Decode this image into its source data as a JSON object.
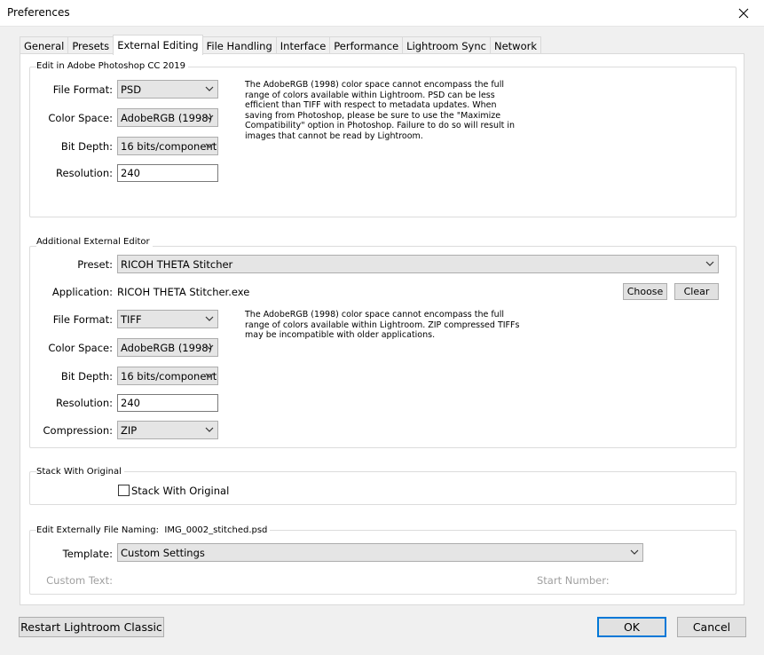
{
  "window": {
    "title": "Preferences"
  },
  "tabs": [
    {
      "label": "General"
    },
    {
      "label": "Presets"
    },
    {
      "label": "External Editing"
    },
    {
      "label": "File Handling"
    },
    {
      "label": "Interface"
    },
    {
      "label": "Performance"
    },
    {
      "label": "Lightroom Sync"
    },
    {
      "label": "Network"
    }
  ],
  "edit_in_photoshop": {
    "title": "Edit in Adobe Photoshop CC 2019",
    "file_format_label": "File Format:",
    "file_format": "PSD",
    "color_space_label": "Color Space:",
    "color_space": "AdobeRGB (1998)",
    "bit_depth_label": "Bit Depth:",
    "bit_depth": "16 bits/component",
    "resolution_label": "Resolution:",
    "resolution": "240",
    "note": "The AdobeRGB (1998) color space cannot encompass the full range of colors available within Lightroom. PSD can be less efficient than TIFF with respect to metadata updates. When saving from Photoshop, please be sure to use the \"Maximize Compatibility\" option in Photoshop. Failure to do so will result in images that cannot be read by Lightroom."
  },
  "additional_editor": {
    "title": "Additional External Editor",
    "preset_label": "Preset:",
    "preset": "RICOH THETA Stitcher",
    "application_label": "Application:",
    "application": "RICOH THETA Stitcher.exe",
    "choose_label": "Choose",
    "clear_label": "Clear",
    "file_format_label": "File Format:",
    "file_format": "TIFF",
    "color_space_label": "Color Space:",
    "color_space": "AdobeRGB (1998)",
    "bit_depth_label": "Bit Depth:",
    "bit_depth": "16 bits/component",
    "resolution_label": "Resolution:",
    "resolution": "240",
    "compression_label": "Compression:",
    "compression": "ZIP",
    "note": "The AdobeRGB (1998) color space cannot encompass the full range of colors available within Lightroom. ZIP compressed TIFFs may be incompatible with older applications."
  },
  "stack": {
    "title": "Stack With Original",
    "checkbox_label": "Stack With Original",
    "checked": false
  },
  "naming": {
    "title": "Edit Externally File Naming:",
    "example": "IMG_0002_stitched.psd",
    "template_label": "Template:",
    "template": "Custom Settings",
    "custom_text_label": "Custom Text:",
    "start_number_label": "Start Number:"
  },
  "footer": {
    "restart_label": "Restart Lightroom Classic",
    "ok_label": "OK",
    "cancel_label": "Cancel"
  },
  "colors": {
    "accent": "#0078d7",
    "window_bg": "#f0f0f0",
    "panel_bg": "#ffffff"
  }
}
